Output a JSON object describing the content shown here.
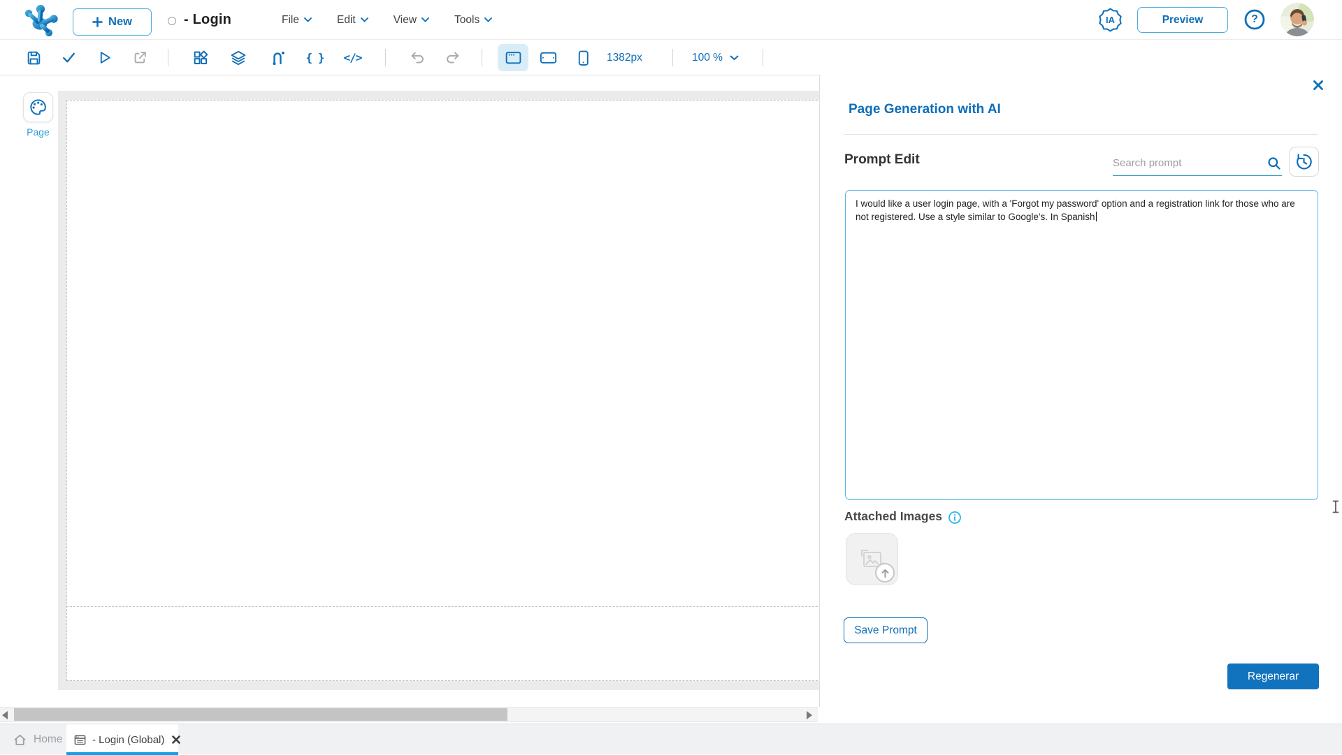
{
  "colors": {
    "primary_blue": "#0e6eb8",
    "light_blue_border": "#4cacdf",
    "bright_blue": "#14a0e6",
    "info_cyan": "#29b4e8",
    "disabled_gray": "#ababab"
  },
  "header": {
    "new_button": "New",
    "title": "- Login",
    "menus": [
      "File",
      "Edit",
      "View",
      "Tools"
    ],
    "ia_badge": "IA",
    "preview_button": "Preview",
    "help_glyph": "?"
  },
  "toolbar": {
    "width_indicator": "1382px",
    "zoom_value": "100 %",
    "braces_glyph": "{ }",
    "code_glyph": "</>"
  },
  "left_palette": {
    "page_label": "Page"
  },
  "ai_panel": {
    "title": "Page Generation with AI",
    "section_title": "Prompt Edit",
    "search_placeholder": "Search prompt",
    "prompt_text": "I would like a user login page, with a 'Forgot my password' option and a registration link for those who are not registered. Use a style similar to Google's. In Spanish",
    "attached_images_label": "Attached Images",
    "save_prompt_button": "Save Prompt",
    "regenerate_button": "Regenerar"
  },
  "status_bar": {
    "home_tab": "Home",
    "active_tab": "- Login (Global)"
  }
}
